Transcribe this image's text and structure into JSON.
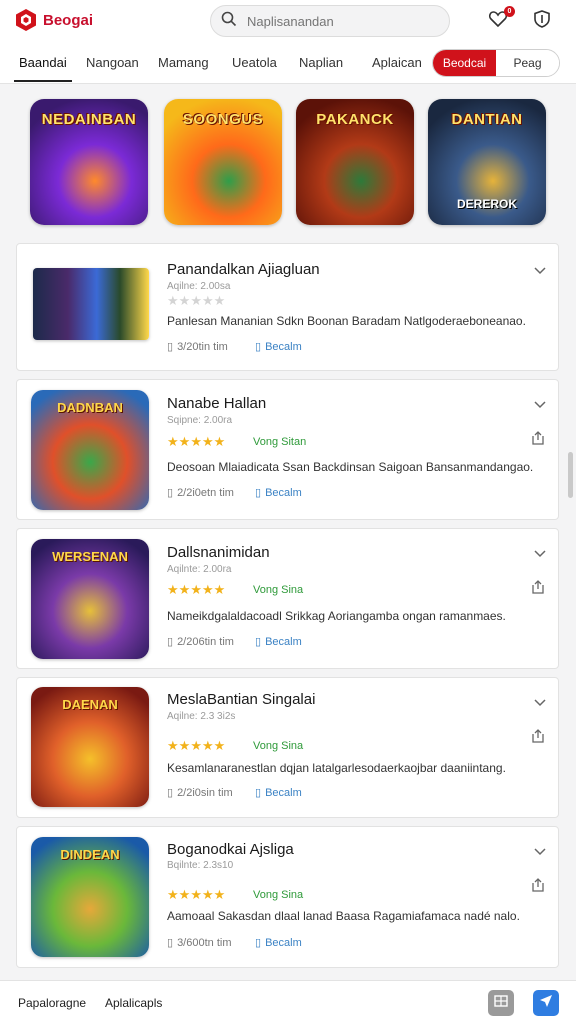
{
  "header": {
    "app_name": "Beogai",
    "search": {
      "placeholder": "Naplisanandan",
      "value": ""
    },
    "notification_count": "0",
    "icons": [
      "logo-hexagon",
      "search-icon",
      "heart-icon",
      "shield-icon"
    ]
  },
  "tabs": {
    "items": [
      "Baandai",
      "Nangoan",
      "Mamang",
      "Ueatola",
      "Naplian",
      "Aplaican"
    ],
    "active_index": 0,
    "segment": {
      "on": "Beodcai",
      "off": "Peag"
    }
  },
  "featured": [
    {
      "title": "NEDAINBAN",
      "subtitle": "",
      "palette": [
        "#3a1a6e",
        "#7b2ad6",
        "#ff8a2b"
      ]
    },
    {
      "title": "SOONGUS",
      "subtitle": "",
      "palette": [
        "#f5b81a",
        "#ff6a1a",
        "#2f9e4a"
      ]
    },
    {
      "title": "PAKANCK",
      "subtitle": "",
      "palette": [
        "#5c1208",
        "#b23a17",
        "#2d7a3a"
      ]
    },
    {
      "title": "DANTIAN",
      "subtitle": "DEREROK",
      "palette": [
        "#1a2840",
        "#3a5a8a",
        "#e6b33a"
      ]
    }
  ],
  "apps": [
    {
      "name": "Panandalkan Ajiagluan",
      "meta": "Aqilne: 2.00sa",
      "rating": 0,
      "tag": "",
      "description": "Panlesan Mananian Sdkn Boonan Baradam Natlgoderaeboneanao.",
      "size": "3/20tin tim",
      "detail": "Becalm",
      "thumb_title": "",
      "palette": [
        "#1c2a4a",
        "#3b6ad6",
        "#ffd84a"
      ],
      "show_share": false
    },
    {
      "name": "Nanabe Hallan",
      "meta": "Sqipne: 2.00ra",
      "rating": 4.5,
      "tag": "Vong Sitan",
      "description": "Deosoan Mlaiadicata Ssan Backdinsan Saigoan Bansanmandangao.",
      "size": "2/2i0etn tim",
      "detail": "Becalm",
      "thumb_title": "DADNBAN",
      "palette": [
        "#2a6ab8",
        "#e0502a",
        "#3aa84a"
      ],
      "show_share": true
    },
    {
      "name": "Dallsnanimidan",
      "meta": "Aqilnte: 2.00ra",
      "rating": 5,
      "tag": "Vong Sina",
      "description": "Nameikdgalaldacoadl Srikkag Aoriangamba ongan ramanmaes.",
      "size": "2/206tin tim",
      "detail": "Becalm",
      "thumb_title": "WERSENAN",
      "palette": [
        "#2a1a5a",
        "#7a3aa8",
        "#e6c03a"
      ],
      "show_share": true
    },
    {
      "name": "MeslaBantian Singalai",
      "meta": "Aqilne: 2.3 3i2s",
      "rating": 5,
      "tag": "Vong Sina",
      "description": "Kesamlanaranestlan dqjan latalgarlesodaerkaojbar daaniintang.",
      "size": "2/2i0sin tim",
      "detail": "Becalm",
      "thumb_title": "DAENAN",
      "palette": [
        "#7a1a12",
        "#e0602a",
        "#f5c02a"
      ],
      "show_share": true
    },
    {
      "name": "Boganodkai Ajsliga",
      "meta": "Bqilnte: 2.3s10",
      "rating": 5,
      "tag": "Vong Sina",
      "description": "Aamoaal Sakasdan dlaal lanad Baasa Ragamiafamaca nadé nalo.",
      "size": "3/600tn tim",
      "detail": "Becalm",
      "thumb_title": "DINDEAN",
      "palette": [
        "#1a5aa8",
        "#6ab83a",
        "#e6a83a"
      ],
      "show_share": true
    }
  ],
  "bottom": {
    "left_links": [
      "Papaloragne",
      "Aplalicapls"
    ],
    "icons": [
      "grid-icon",
      "compass-icon"
    ]
  },
  "colors": {
    "brand_red": "#d0121b",
    "star": "#f2b21b",
    "green_tag": "#2f9a3a",
    "link_blue": "#3b82c4"
  }
}
